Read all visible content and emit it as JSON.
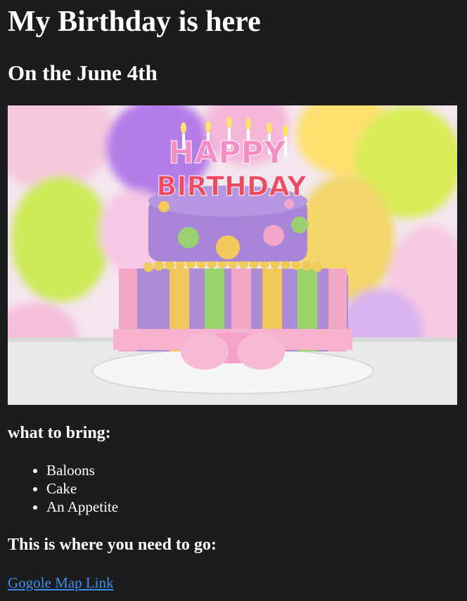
{
  "page": {
    "title": "My Birthday is here",
    "subtitle": "On the June 4th"
  },
  "hero_image": {
    "candle_text_top": "HAPPY",
    "candle_text_bottom": "BIRTHDAY"
  },
  "bring": {
    "heading": "what to bring:",
    "items": [
      "Baloons",
      "Cake",
      "An Appetite"
    ]
  },
  "location": {
    "heading": "This is where you need to go:",
    "link_text": "Gogole Map Link"
  },
  "colors": {
    "background": "#1b1c1e",
    "text": "#ffffff",
    "link": "#3b8eea"
  }
}
